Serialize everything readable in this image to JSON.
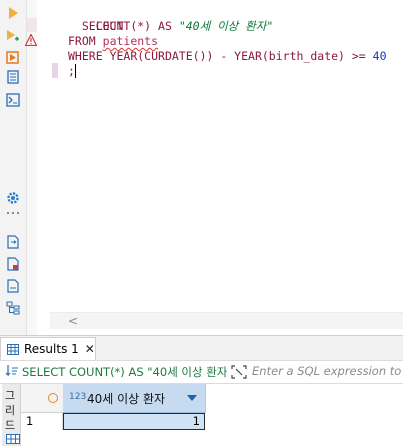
{
  "editor": {
    "lines": [
      {
        "kw": "SELECT"
      },
      {
        "indent": "    ",
        "fn": "COUNT(*)",
        "as": "AS",
        "alias": "\"40세 이상 환자\""
      },
      {
        "kw": "FROM",
        "table": "patients"
      },
      {
        "kw": "WHERE",
        "expr_pre": "YEAR(CURDATE()) - YEAR(birth_date) >= ",
        "num": "40"
      },
      {
        "text": ";"
      }
    ],
    "scroll_left_glyph": "<"
  },
  "results": {
    "tab_label": "Results 1",
    "tab_close": "✕",
    "filter_query": "SELECT COUNT(*) AS \"40세 이상 환자\"",
    "filter_placeholder": "Enter a SQL expression to filter results",
    "vertical_tab": [
      "그",
      "리",
      "드"
    ],
    "column": {
      "type_badge": "123",
      "name": "40세 이상 환자"
    },
    "rows": [
      {
        "num": "1",
        "value": "1"
      }
    ]
  },
  "colors": {
    "keyword": "#8b1a3a",
    "string": "#0a7a3a",
    "number": "#1a35c7",
    "header_bg": "#c6dbf0",
    "selected_cell": "#cfe3f6"
  },
  "icons": {
    "toolstrip": [
      "run-statement-icon",
      "run-script-icon",
      "execute-plan-icon",
      "explain-icon",
      "terminal-icon",
      "settings-icon",
      "export-icon",
      "new-script-icon",
      "load-script-icon",
      "outline-icon"
    ],
    "gutter_warning": "warning-icon",
    "tab": "grid-table-icon",
    "filter": "filter-icon",
    "expression": "expression-icon"
  }
}
